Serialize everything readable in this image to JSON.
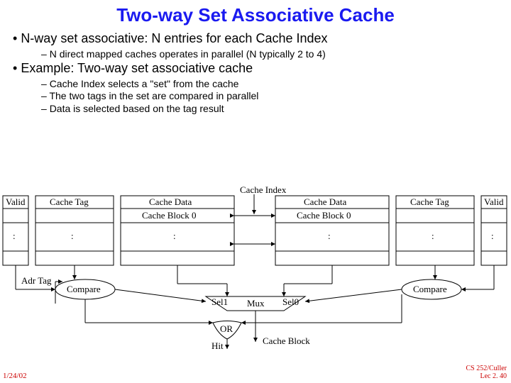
{
  "title": "Two-way Set Associative Cache",
  "b1": "N-way set associative: N entries for each Cache Index",
  "b1s1": "N direct mapped caches operates in parallel (N typically 2 to 4)",
  "b2": "Example: Two-way set associative cache",
  "b2s1": "Cache Index selects a \"set\" from the cache",
  "b2s2": "The two tags in the set are compared in parallel",
  "b2s3": "Data is selected based on the tag result",
  "lbl": {
    "valid_l": "Valid",
    "tag_l": "Cache Tag",
    "data_l": "Cache Data",
    "block_l": "Cache Block 0",
    "adr_tag": "Adr Tag",
    "compare_l": "Compare",
    "cache_index": "Cache Index",
    "data_r": "Cache Data",
    "block_r": "Cache Block 0",
    "tag_r": "Cache Tag",
    "valid_r": "Valid",
    "compare_r": "Compare",
    "sel1": "Sel1",
    "sel0": "Sel0",
    "mux": "Mux",
    "or": "OR",
    "hit": "Hit",
    "cache_block": "Cache Block",
    "dots": ":"
  },
  "footer": {
    "date": "1/24/02",
    "course1": "CS 252/Culler",
    "course2": "Lec 2. 40"
  }
}
